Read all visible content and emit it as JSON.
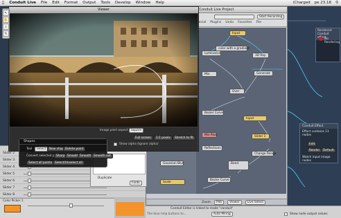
{
  "menubar": {
    "app_name": "Conduit Live",
    "items": [
      "File",
      "Edit",
      "Format",
      "Output",
      "Tools",
      "Develop",
      "Window",
      "Help"
    ],
    "user": "iCharged",
    "clock": "pe 23.18"
  },
  "tools": [
    "↖",
    "✋",
    "⌕",
    "✎"
  ],
  "project": {
    "title": "Conduit Live Project",
    "tabs": [
      "Special",
      "Plugins",
      "Undo",
      "Favorites",
      "File"
    ],
    "record_label": "Start Recording",
    "nodes": [
      {
        "label": "Input",
        "kind": "yellow"
      },
      {
        "label": "Luminance",
        "kind": "grey"
      },
      {
        "label": "color with a gradient",
        "kind": "grey"
      },
      {
        "label": "Mix",
        "kind": "grey"
      },
      {
        "label": "3D Ray",
        "kind": "grey"
      },
      {
        "label": "Generate",
        "kind": "grey"
      },
      {
        "label": "Over",
        "kind": "grey"
      },
      {
        "label": "Bezier Curve",
        "kind": "grey"
      },
      {
        "label": "Input",
        "kind": "yellow"
      },
      {
        "label": "Mix Pass",
        "kind": "red"
      },
      {
        "label": "Reflections",
        "kind": "grey"
      },
      {
        "label": "Slider 1",
        "kind": "yellow"
      },
      {
        "label": "Change Range",
        "kind": "grey"
      },
      {
        "label": "Bend",
        "kind": "grey"
      },
      {
        "label": "Gaussian Blur",
        "kind": "grey"
      },
      {
        "label": "Bezier Curve",
        "kind": "grey"
      },
      {
        "label": "Scale",
        "kind": "yellow"
      }
    ],
    "bottom_buttons": [
      "Plot",
      "Viewer",
      "Live Select"
    ],
    "zoom_label": "Zoom"
  },
  "viewer": {
    "title": "Viewer",
    "image_pixel_aspect_label": "Image pixel aspect",
    "aspect_value": "Square",
    "show_alpha_label": "Show alpha (Ignore alpha)",
    "zoom_buttons": [
      "Full screen",
      "1:1 pixels",
      "Stretch to fit"
    ]
  },
  "shapes": {
    "title": "Shapes",
    "tool_label": "Tool",
    "tool_buttons": [
      "Select",
      "New shape",
      "Delete point"
    ],
    "convert_label": "Convert selected points",
    "convert_buttons": [
      "Sharp",
      "Smooth",
      "Smooth in",
      "Smooth out"
    ],
    "select_buttons": [
      "Select all points",
      "Select/Unselect all"
    ]
  },
  "sliders": [
    {
      "label": "Slider 2",
      "value": 0.3
    },
    {
      "label": "Slider 3",
      "value": 0.05
    },
    {
      "label": "Slider 4",
      "value": 0.05
    },
    {
      "label": "Slider 5",
      "value": 0.05
    },
    {
      "label": "Slider 6",
      "value": 0.05
    },
    {
      "label": "Slider 7",
      "value": 0.05
    },
    {
      "label": "Slider 8",
      "value": 0.05
    }
  ],
  "color_picker": {
    "label": "Color Picker 1",
    "swatch_color": "#f3942b"
  },
  "list_panel": {
    "items": [
      "Duplicate",
      "Fonts"
    ]
  },
  "effect_panel": {
    "title": "Conduit Effect",
    "items": [
      "Effect contains 11 nodes",
      "Edit",
      "Render",
      "Default",
      "Watch input image nodes"
    ]
  },
  "preview_panel": {
    "title": "Rendered Conduit effect",
    "items": [
      "No Rendering"
    ]
  },
  "status": {
    "message": "Conduit Editor is linked to mode \"conduit\"",
    "auto_button": "Auto Miring",
    "checkbox_label": "Show node output values",
    "hint": "The blue help buttons to..."
  },
  "colors": {
    "accent": "#4ed0ff",
    "orange": "#f3942b",
    "node_yellow": "#e9c86a"
  }
}
